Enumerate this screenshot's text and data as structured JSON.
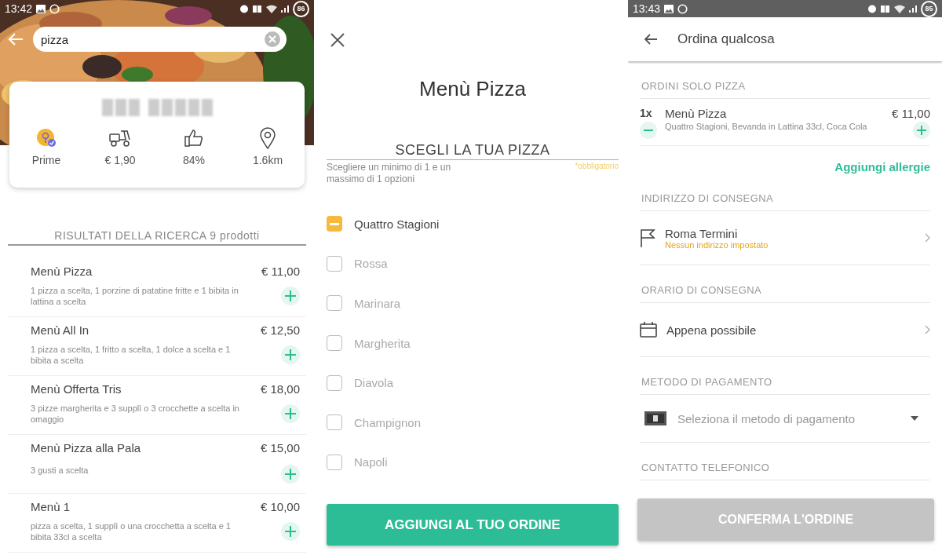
{
  "search_screen": {
    "status_bar": {
      "time": "13:42",
      "battery": "86"
    },
    "search": {
      "value": "pizza"
    },
    "restaurant_card": {
      "stats": [
        {
          "kind": "prime",
          "label": "Prime"
        },
        {
          "kind": "delivery",
          "label": "€ 1,90"
        },
        {
          "kind": "rating",
          "label": "84%"
        },
        {
          "kind": "distance",
          "label": "1.6km"
        }
      ]
    },
    "results_heading": "RISULTATI DELLA RICERCA 9 prodotti",
    "products": [
      {
        "name": "Menù Pizza",
        "description": "1 pizza a scelta, 1 porzine di patatine fritte e 1 bibita in lattina a scelta",
        "price": "€ 11,00"
      },
      {
        "name": "Menù All In",
        "description": "1 pizza a scelta, 1 fritto a scelta, 1 dolce a scelta e 1 bibita a scelta",
        "price": "€ 12,50"
      },
      {
        "name": "Menù Offerta Tris",
        "description": "3 pizze margherita e 3 supplì o 3 crocchette a scelta in omaggio",
        "price": "€ 18,00"
      },
      {
        "name": "Menù Pizza alla Pala",
        "description": "3 gusti a scelta",
        "price": "€ 15,00"
      },
      {
        "name": "Menù 1",
        "description": "pizza a scelta, 1 supplì o una crocchetta a scelta e 1 bibita 33cl a scelta",
        "price": "€ 10,00"
      }
    ]
  },
  "options_screen": {
    "title": "Menù Pizza",
    "section_title": "SCEGLI LA TUA PIZZA",
    "hint": "Scegliere un minimo di 1 e un massimo di 1 opzioni",
    "required_label": "*obbligatorio",
    "options": [
      {
        "label": "Quattro Stagioni",
        "selected": true
      },
      {
        "label": "Rossa",
        "selected": false
      },
      {
        "label": "Marinara",
        "selected": false
      },
      {
        "label": "Margherita",
        "selected": false
      },
      {
        "label": "Diavola",
        "selected": false
      },
      {
        "label": "Champignon",
        "selected": false
      },
      {
        "label": "Napoli",
        "selected": false
      }
    ],
    "add_button": "AGGIUNGI AL TUO ORDINE"
  },
  "order_screen": {
    "status_bar": {
      "time": "13:43",
      "battery": "85"
    },
    "title": "Ordina qualcosa",
    "order_heading": "ORDINI SOLO PIZZA",
    "order_item": {
      "quantity": "1x",
      "name": "Menù Pizza",
      "details": "Quattro Stagioni, Bevanda in Lattina 33cl, Coca Cola",
      "price": "€ 11,00"
    },
    "allergies_link": "Aggiungi allergie",
    "address_heading": "INDIRIZZO DI CONSEGNA",
    "address": {
      "name": "Roma Termini",
      "note": "Nessun indirizzo impostato"
    },
    "time_heading": "ORARIO DI CONSEGNA",
    "delivery_time": "Appena possibile",
    "payment_heading": "METODO DI PAGAMENTO",
    "payment": {
      "placeholder": "Seleziona il metodo di pagamento"
    },
    "phone_heading": "CONTATTO TELEFONICO",
    "confirm_button": {
      "label": "CONFERMA L'ORDINE",
      "disabled": true
    }
  }
}
